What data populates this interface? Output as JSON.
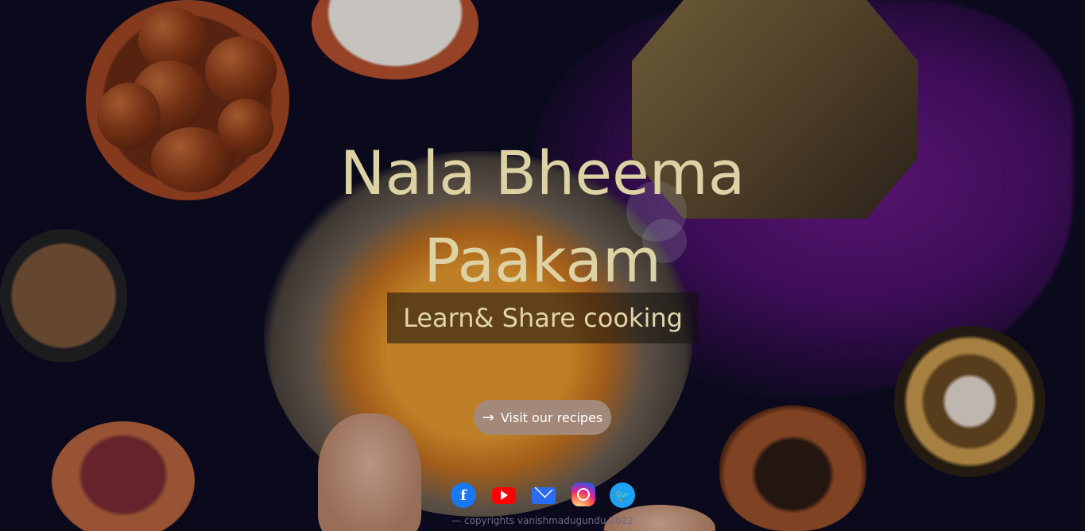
{
  "hero": {
    "title_line1": "Nala Bheema",
    "title_line2": "Paakam",
    "subtitle": "Learn& Share cooking",
    "cta_label": "Visit our recipes",
    "cta_icon": "arrow-right-icon"
  },
  "socials": [
    {
      "name": "facebook",
      "glyph": "f",
      "color": "#1877f2"
    },
    {
      "name": "youtube",
      "glyph": "",
      "color": "#ff0000"
    },
    {
      "name": "email",
      "glyph": "",
      "color": "#2a6cf0"
    },
    {
      "name": "instagram",
      "glyph": "",
      "color": "#d6249f"
    },
    {
      "name": "twitter",
      "glyph": "🐦",
      "color": "#1da1f2"
    }
  ],
  "footer": {
    "copyright": "— copyrights vanishmadugundu 2022"
  },
  "colors": {
    "title": "#ddd2a3",
    "cta_bg": "#a3897a",
    "background": "#0d0b1f"
  }
}
